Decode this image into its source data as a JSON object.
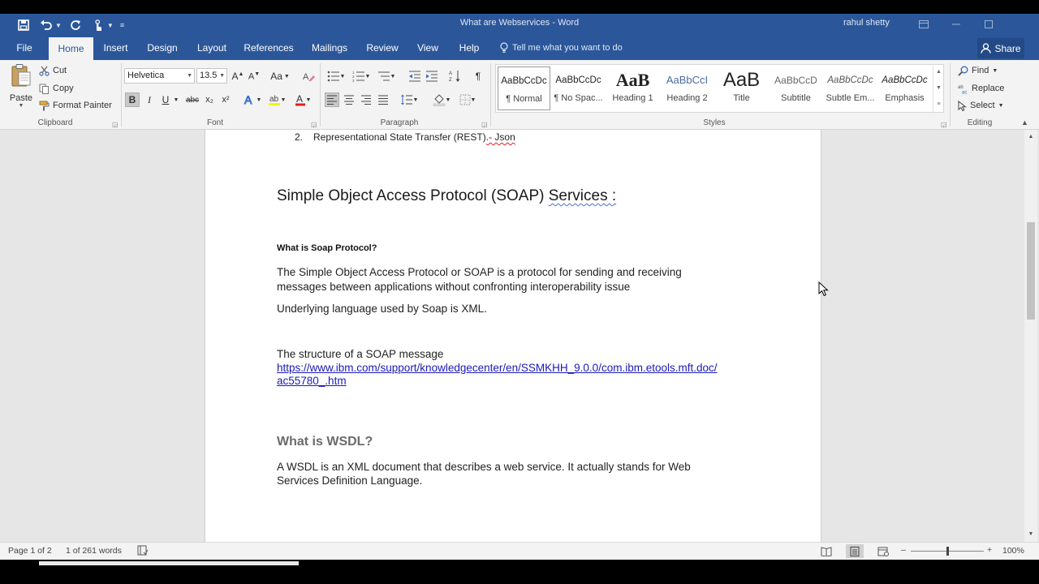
{
  "window": {
    "doc_title": "What are Webservices",
    "app_name": "Word",
    "title_separator": " - ",
    "username": "rahul shetty"
  },
  "tabs": [
    {
      "label": "File"
    },
    {
      "label": "Home",
      "active": true
    },
    {
      "label": "Insert"
    },
    {
      "label": "Design"
    },
    {
      "label": "Layout"
    },
    {
      "label": "References"
    },
    {
      "label": "Mailings"
    },
    {
      "label": "Review"
    },
    {
      "label": "View"
    },
    {
      "label": "Help"
    }
  ],
  "tell_me": "Tell me what you want to do",
  "share_label": "Share",
  "clipboard": {
    "paste_label": "Paste",
    "cut_label": "Cut",
    "copy_label": "Copy",
    "format_painter_label": "Format Painter",
    "group_label": "Clipboard"
  },
  "font": {
    "font_name": "Helvetica",
    "font_size": "13.5",
    "change_case_label": "Aa",
    "bold_label": "B",
    "italic_label": "I",
    "underline_label": "U",
    "strike_label": "abc",
    "subscript_label": "x₂",
    "superscript_label": "x²",
    "font_color": "#e02020",
    "highlight_color": "#f5f500",
    "group_label": "Font"
  },
  "paragraph": {
    "group_label": "Paragraph"
  },
  "styles": {
    "group_label": "Styles",
    "items": [
      {
        "preview": "AaBbCcDc",
        "name": "¶ Normal",
        "selected": true
      },
      {
        "preview": "AaBbCcDc",
        "name": "¶ No Spac..."
      },
      {
        "preview": "AaB",
        "name": "Heading 1"
      },
      {
        "preview": "AaBbCcI",
        "name": "Heading 2"
      },
      {
        "preview": "AaB",
        "name": "Title"
      },
      {
        "preview": "AaBbCcD",
        "name": "Subtitle"
      },
      {
        "preview": "AaBbCcDc",
        "name": "Subtle Em..."
      },
      {
        "preview": "AaBbCcDc",
        "name": "Emphasis"
      }
    ]
  },
  "editing": {
    "find_label": "Find",
    "replace_label": "Replace",
    "select_label": "Select",
    "group_label": "Editing"
  },
  "document": {
    "list_number": "2.",
    "list_text_main": "Representational State Transfer (REST)",
    "list_text_tail": ".- Json",
    "heading_soap_main": "Simple Object Access Protocol (SOAP) ",
    "heading_soap_tail": "Services  :",
    "what_is_soap": "What is Soap Protocol?",
    "soap_para_line1": "The Simple Object Access Protocol or SOAP is a protocol for sending and receiving",
    "soap_para_line2": "messages between applications without confronting interoperability issue",
    "underlying": "Underlying language used by Soap is XML.",
    "structure": "The structure of a SOAP message",
    "link_line1": "https://www.ibm.com/support/knowledgecenter/en/SSMKHH_9.0.0/com.ibm.etools.mft.doc/",
    "link_line2": "ac55780_.htm",
    "wsdl_heading": "What is WSDL?",
    "wsdl_para_line1": " A WSDL is an XML document that describes a web service. It actually stands for Web",
    "wsdl_para_line2": "Services Definition Language."
  },
  "status": {
    "page": "Page 1 of 2",
    "words": "1 of 261 words",
    "zoom": "100%",
    "zoom_minus": "–",
    "zoom_plus": "+"
  }
}
